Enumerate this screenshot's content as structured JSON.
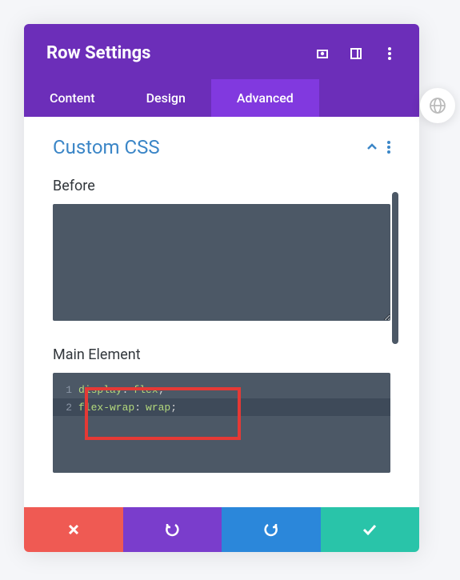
{
  "header": {
    "title": "Row Settings"
  },
  "tabs": {
    "content": "Content",
    "design": "Design",
    "advanced": "Advanced"
  },
  "section": {
    "title": "Custom CSS"
  },
  "fields": {
    "before_label": "Before",
    "main_label": "Main Element"
  },
  "code": {
    "lines": [
      {
        "num": "1",
        "property": "display",
        "value": "flex"
      },
      {
        "num": "2",
        "property": "flex-wrap",
        "value": "wrap"
      }
    ]
  }
}
